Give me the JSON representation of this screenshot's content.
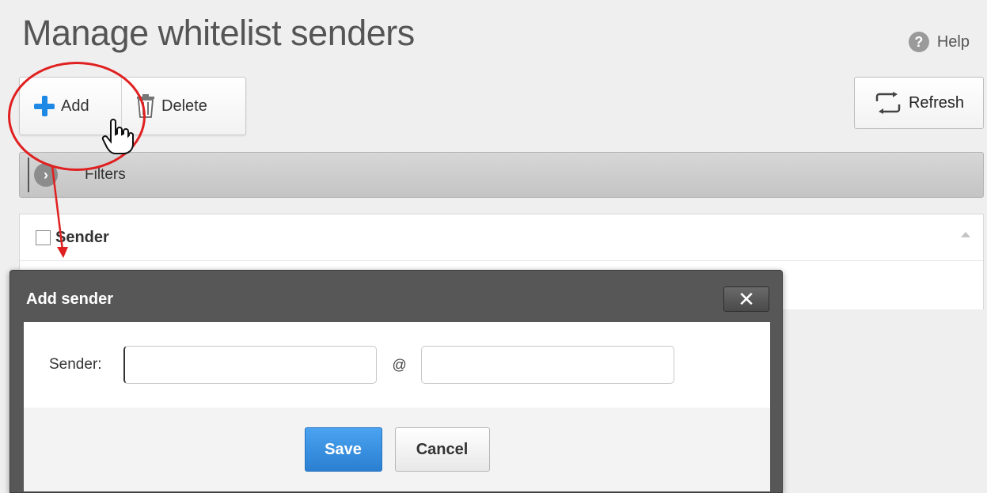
{
  "page": {
    "title": "Manage whitelist senders",
    "help_label": "Help"
  },
  "toolbar": {
    "add_label": "Add",
    "delete_label": "Delete",
    "refresh_label": "Refresh"
  },
  "filters": {
    "label": "Filters"
  },
  "grid": {
    "columns": [
      "Sender"
    ]
  },
  "dialog": {
    "title": "Add sender",
    "sender_label": "Sender:",
    "at_symbol": "@",
    "sender_user_value": "",
    "sender_domain_value": "",
    "save_label": "Save",
    "cancel_label": "Cancel",
    "close_glyph": "✕"
  },
  "icons": {
    "help": "help-icon",
    "add": "plus-icon",
    "delete": "trash-icon",
    "refresh": "refresh-icon",
    "filters_toggle": "chevron-right-icon",
    "close": "close-icon",
    "sort": "sort-up-icon"
  },
  "colors": {
    "accent": "#1e88e5",
    "save_button": "#2b7fd1",
    "dialog_header": "#575757",
    "annotation": "#e02020"
  }
}
